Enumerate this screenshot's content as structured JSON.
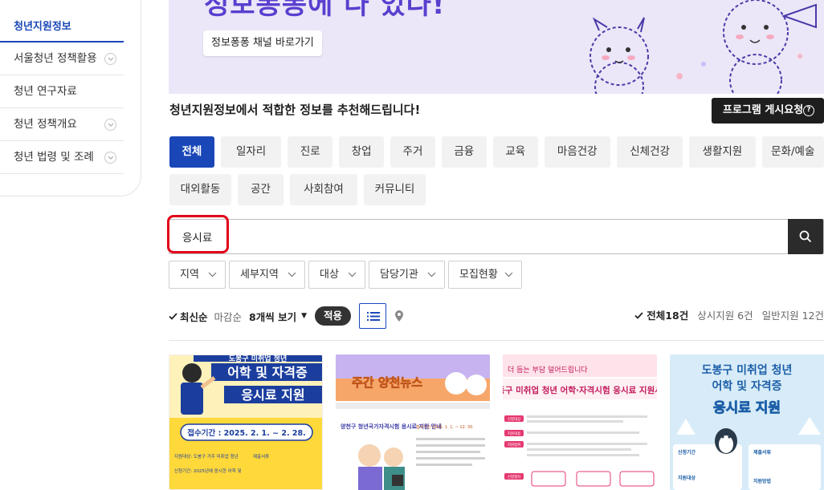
{
  "sidebar": {
    "items": [
      {
        "label": "청년지원정보",
        "active": true,
        "expandable": false
      },
      {
        "label": "서울청년 정책활용",
        "active": false,
        "expandable": true
      },
      {
        "label": "청년 연구자료",
        "active": false,
        "expandable": false
      },
      {
        "label": "청년 정책개요",
        "active": false,
        "expandable": true
      },
      {
        "label": "청년 법령 및 조례",
        "active": false,
        "expandable": true
      }
    ]
  },
  "banner": {
    "headline": "정보퐁퐁에 다 있다!",
    "channel_button": "정보퐁퐁 채널 바로가기"
  },
  "recommend": {
    "title": "청년지원정보에서 적합한 정보를 추천해드립니다!",
    "request_button": "프로그램 게시요청",
    "help_glyph": "?"
  },
  "categories": {
    "row1": [
      "전체",
      "일자리",
      "진로",
      "창업",
      "주거",
      "금융",
      "교육",
      "마음건강",
      "신체건강",
      "생활지원",
      "문화/예술"
    ],
    "row2": [
      "대외활동",
      "공간",
      "사회참여",
      "커뮤니티"
    ],
    "active": "전체"
  },
  "search": {
    "value": "응시료"
  },
  "filters": [
    "지역",
    "세부지역",
    "대상",
    "담당기관",
    "모집현황"
  ],
  "sort": {
    "latest": "최신순",
    "deadline": "마감순",
    "per_page": "8개씩 보기",
    "apply": "적용"
  },
  "counts": {
    "total": "전체18건",
    "always": "상시지원 6건",
    "general": "일반지원 12건"
  },
  "cards": [
    {
      "title_top": "도봉구 미취업 청년",
      "title_main": "어학 및 자격증",
      "title_sub": "응시료 지원",
      "period": "접수기간 : 2025. 2. 1. ~ 2. 28.",
      "note1": "지원대상: 도봉구 거주 미취업 청년",
      "note2": "신청기간: 2025년에 응시한 어학 및",
      "note3": "제출서류"
    },
    {
      "title": "주간 양천뉴스",
      "line": "양천구 청년국가자격시험 응시료 지원 안내",
      "meta": "접수기간 2025. 1. 1. ~ 12. 30."
    },
    {
      "header": "더 듬는 부담 덜어드립니다",
      "title": "성동구 미취업 청년 어학·자격시험 응시료 지원사업",
      "badge1": "신청대상",
      "badge2": "지원내용",
      "badge3": "지원범위",
      "badge4": "신청절차"
    },
    {
      "title1": "도봉구 미취업 청년",
      "title2": "어학 및 자격증",
      "title3": "응시료 지원",
      "label1": "신청기간",
      "label2": "지원대상",
      "label3": "제출서류",
      "label4": "지원방법"
    }
  ],
  "colors": {
    "primary": "#1a47b8",
    "highlight": "#e2001a",
    "dark": "#1e1e1e"
  }
}
